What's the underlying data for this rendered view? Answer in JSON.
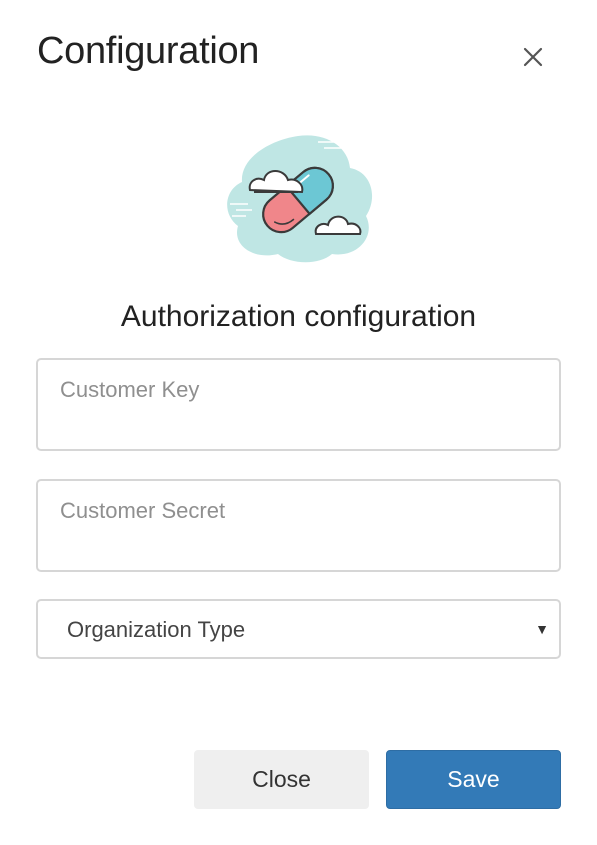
{
  "dialog": {
    "title": "Configuration",
    "subtitle": "Authorization configuration"
  },
  "illustration": {
    "icon": "pill-with-clouds-icon",
    "colors": {
      "blob": "#bfe6e4",
      "pill_red": "#f0868a",
      "pill_blue": "#6cc7d4",
      "cloud": "#ffffff"
    }
  },
  "form": {
    "customer_key": {
      "placeholder": "Customer Key",
      "value": ""
    },
    "customer_secret": {
      "placeholder": "Customer Secret",
      "value": ""
    },
    "organization_type": {
      "selected": "Organization Type"
    }
  },
  "footer": {
    "close_label": "Close",
    "save_label": "Save"
  },
  "colors": {
    "primary": "#337ab7",
    "secondary": "#efefef"
  }
}
